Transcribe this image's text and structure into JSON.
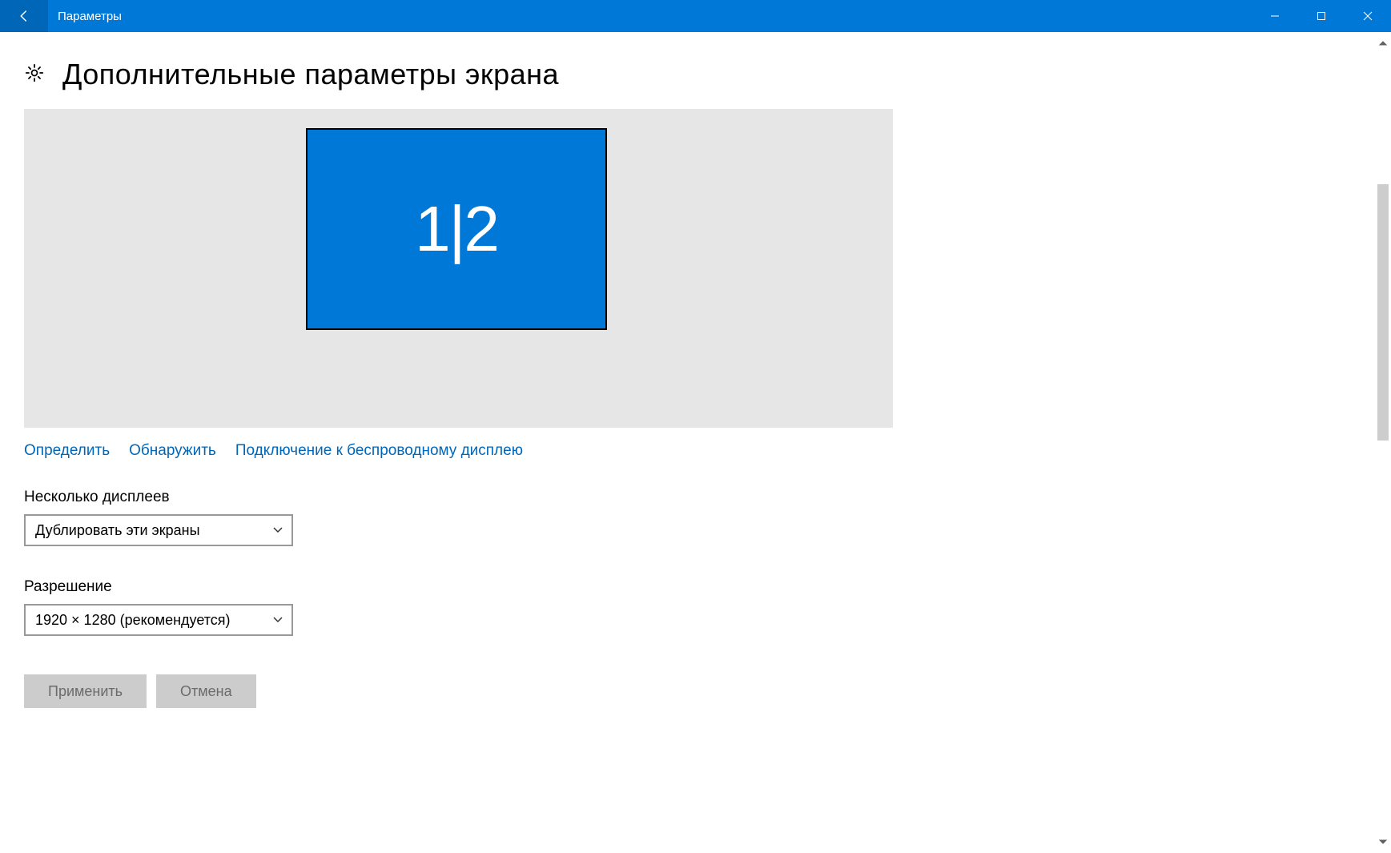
{
  "titlebar": {
    "title": "Параметры"
  },
  "header": {
    "page_title": "Дополнительные параметры экрана"
  },
  "monitor": {
    "label": "1|2"
  },
  "links": {
    "identify": "Определить",
    "detect": "Обнаружить",
    "wireless": "Подключение к беспроводному дисплею"
  },
  "multiple_displays": {
    "label": "Несколько дисплеев",
    "value": "Дублировать эти экраны"
  },
  "resolution": {
    "label": "Разрешение",
    "value": "1920 × 1280 (рекомендуется)"
  },
  "actions": {
    "apply": "Применить",
    "cancel": "Отмена"
  }
}
